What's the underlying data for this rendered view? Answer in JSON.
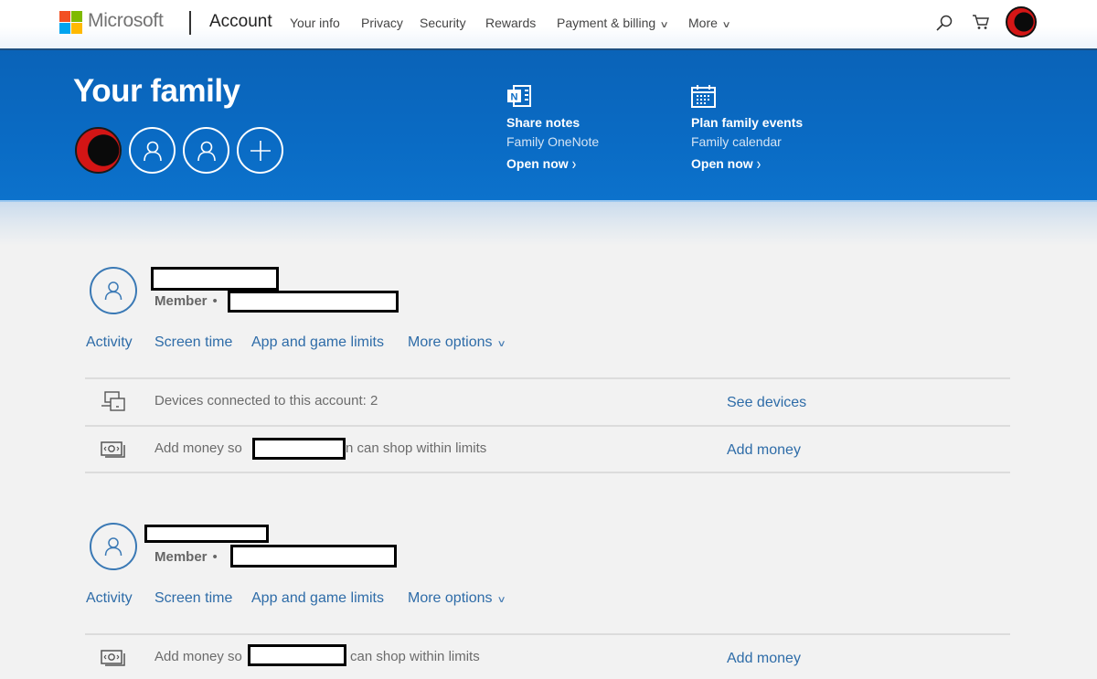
{
  "topnav": {
    "brand": "Microsoft",
    "section": "Account",
    "logo_colors": [
      "#f25022",
      "#7fba00",
      "#00a4ef",
      "#ffb900"
    ],
    "links": [
      {
        "label": "Your info",
        "dropdown": false
      },
      {
        "label": "Privacy",
        "dropdown": false
      },
      {
        "label": "Security",
        "dropdown": false
      },
      {
        "label": "Rewards",
        "dropdown": false
      },
      {
        "label": "Payment & billing",
        "dropdown": true
      },
      {
        "label": "More",
        "dropdown": true
      }
    ],
    "icons": [
      "search-icon",
      "cart-icon",
      "profile-avatar"
    ]
  },
  "hero": {
    "title": "Your family",
    "background": "#0a6bc4",
    "members": [
      "profile-avatar",
      "person-icon",
      "person-icon",
      "add-icon"
    ],
    "promos": [
      {
        "icon": "onenote-icon",
        "title": "Share notes",
        "subtitle": "Family OneNote",
        "link": "Open now",
        "link_icon": "chevron-right"
      },
      {
        "icon": "calendar-icon",
        "title": "Plan family events",
        "subtitle": "Family calendar",
        "link": "Open now",
        "link_icon": "chevron-right"
      }
    ]
  },
  "members": [
    {
      "name": "[redacted]",
      "role": "Member",
      "separator": "•",
      "email": "[redacted]",
      "tabs": [
        "Activity",
        "Screen time",
        "App and game limits",
        "More options"
      ],
      "rows": [
        {
          "icon": "devices-icon",
          "text": "Devices connected to this account: 2",
          "action": "See devices"
        },
        {
          "icon": "money-icon",
          "text_before": "Add money so",
          "text_after": "n can shop within limits",
          "action": "Add money"
        }
      ]
    },
    {
      "name": "[redacted]",
      "role": "Member",
      "separator": "•",
      "email": "[redacted]",
      "tabs": [
        "Activity",
        "Screen time",
        "App and game limits",
        "More options"
      ],
      "rows": [
        {
          "icon": "money-icon",
          "text_before": "Add money so",
          "text_after": "can shop within limits",
          "action": "Add money"
        }
      ]
    }
  ],
  "colors": {
    "link": "#2e6ca8",
    "page_background": "#f2f2f2"
  }
}
